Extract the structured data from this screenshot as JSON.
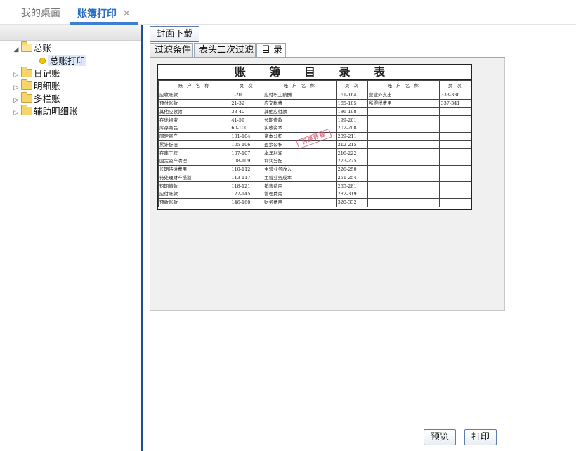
{
  "topbar": {
    "home_tab": "我的桌面",
    "active_tab": "账簿打印",
    "close_glyph": "✕"
  },
  "tree": {
    "root": "总账",
    "child": "总账打印",
    "others": [
      "日记账",
      "明细账",
      "多栏账",
      "辅助明细账"
    ]
  },
  "toolbar": {
    "cover_download": "封面下载",
    "tabs": [
      "过滤条件",
      "表头二次过滤",
      "目 录"
    ],
    "active_tab": 2
  },
  "document": {
    "title": "账 簿 目 录 表",
    "headers": [
      "账 户 名 称",
      "页 次",
      "账 户 名 称",
      "页 次",
      "账 户 名 称",
      "页 次"
    ],
    "rows": [
      [
        "应收账款",
        "1-20",
        "应付职工薪酬",
        "161-164",
        "营业外支出",
        "333-336"
      ],
      [
        "预付账款",
        "21-32",
        "应交税费",
        "165-185",
        "所得税费用",
        "337-341"
      ],
      [
        "其他应收款",
        "33-40",
        "其他应付款",
        "186-198",
        "",
        ""
      ],
      [
        "在途物资",
        "41-59",
        "长期借款",
        "199-201",
        "",
        ""
      ],
      [
        "库存商品",
        "60-100",
        "实收资本",
        "202-208",
        "",
        ""
      ],
      [
        "固定资产",
        "101-104",
        "资本公积",
        "209-211",
        "",
        ""
      ],
      [
        "累计折旧",
        "105-106",
        "盈余公积",
        "212-215",
        "",
        ""
      ],
      [
        "在建工程",
        "107-107",
        "本年利润",
        "216-222",
        "",
        ""
      ],
      [
        "固定资产清理",
        "108-109",
        "利润分配",
        "223-225",
        "",
        ""
      ],
      [
        "长期待摊费用",
        "110-112",
        "主营业务收入",
        "226-250",
        "",
        ""
      ],
      [
        "待处理财产损溢",
        "113-117",
        "主营业务成本",
        "251-254",
        "",
        ""
      ],
      [
        "短期借款",
        "118-121",
        "销售费用",
        "255-281",
        "",
        ""
      ],
      [
        "应付账款",
        "122-145",
        "管理费用",
        "282-319",
        "",
        ""
      ],
      [
        "预收账款",
        "146-160",
        "财务费用",
        "320-332",
        "",
        ""
      ]
    ],
    "stamp": "百果教程"
  },
  "footer": {
    "preview": "预览",
    "print": "打印"
  }
}
